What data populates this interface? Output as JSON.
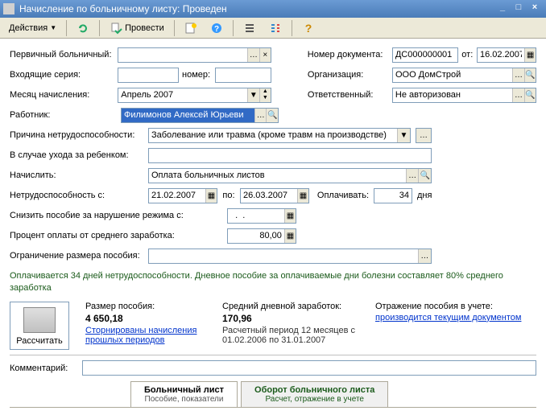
{
  "window": {
    "title": "Начисление по больничному листу: Проведен"
  },
  "toolbar": {
    "actions": "Действия",
    "run": "Провести"
  },
  "labels": {
    "primary": "Первичный больничный:",
    "docnum": "Номер документа:",
    "from": "от:",
    "inseries": "Входящие серия:",
    "number": "номер:",
    "org": "Организация:",
    "month": "Месяц начисления:",
    "resp": "Ответственный:",
    "worker": "Работник:",
    "reason": "Причина нетрудоспособности:",
    "childcare": "В случае ухода за ребенком:",
    "charge": "Начислить:",
    "disab_from": "Нетрудоспособность с:",
    "to": "по:",
    "pay": "Оплачивать:",
    "days": "дня",
    "reduce": "Снизить пособие за нарушение режима с:",
    "percent": "Процент оплаты от среднего заработка:",
    "limit": "Ограничение размера пособия:",
    "comment": "Комментарий:"
  },
  "values": {
    "docnum": "ДС000000001",
    "docdate": "16.02.2007",
    "org": "ООО ДомСтрой",
    "month": "Апрель 2007",
    "resp": "Не авторизован",
    "worker": "Филимонов Алексей Юрьеви",
    "reason": "Заболевание или травма (кроме травм на производстве)",
    "charge": "Оплата больничных листов",
    "date_from": "21.02.2007",
    "date_to": "26.03.2007",
    "pay_days": "34",
    "reduce_date": "  .  .",
    "percent": "80,00"
  },
  "hint": "Оплачивается 34 дней нетрудоспособности. Дневное пособие за оплачиваемые дни болезни составляет 80% среднего заработка",
  "summary": {
    "calc_btn": "Рассчитать",
    "size_lbl": "Размер пособия:",
    "size_val": "4 650,18",
    "storn": "Сторнированы начисления прошлых периодов",
    "avg_lbl": "Средний дневной заработок:",
    "avg_val": "170,96",
    "period": "Расчетный период 12 месяцев с 01.02.2006 по 31.01.2007",
    "refl_lbl": "Отражение пособия в учете:",
    "refl_val": "производится текущим документом"
  },
  "tabs": {
    "t1": "Больничный лист",
    "t1s": "Пособие, показатели",
    "t2": "Оборот больничного листа",
    "t2s": "Расчет, отражение в учете"
  }
}
